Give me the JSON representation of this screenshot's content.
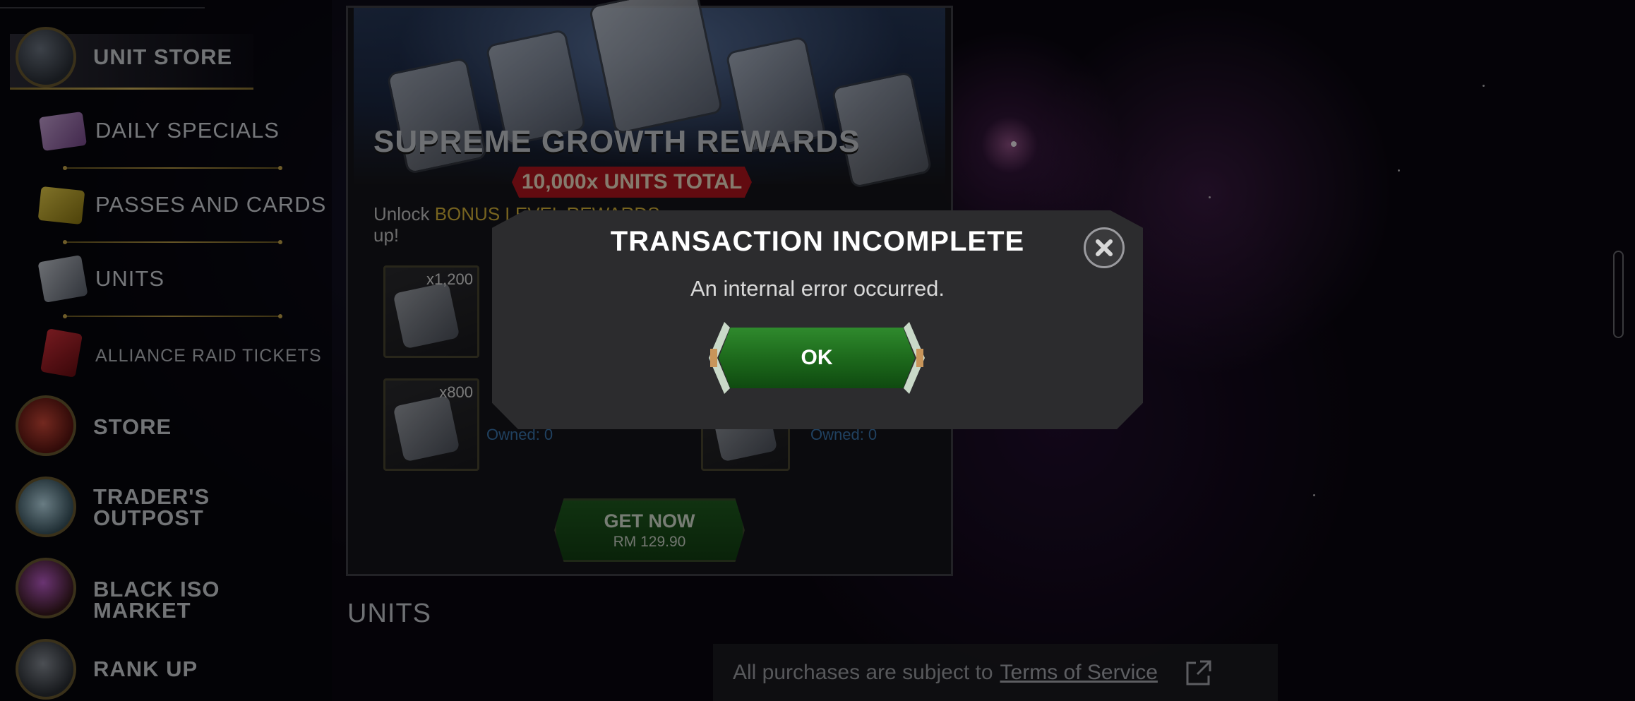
{
  "sidebar": {
    "items": [
      {
        "label": "UNIT STORE",
        "icon": "unit-store-icon"
      },
      {
        "label": "DAILY SPECIALS",
        "icon": "daily-specials-icon"
      },
      {
        "label": "PASSES AND CARDS",
        "icon": "passes-cards-icon"
      },
      {
        "label": "UNITS",
        "icon": "units-icon"
      },
      {
        "label": "ALLIANCE RAID TICKETS",
        "icon": "raid-ticket-icon"
      },
      {
        "label": "STORE",
        "icon": "store-icon"
      },
      {
        "label": "TRADER'S OUTPOST",
        "icon": "crystal-icon"
      },
      {
        "label": "BLACK ISO MARKET",
        "icon": "black-iso-icon"
      },
      {
        "label": "RANK UP",
        "icon": "rank-up-icon"
      }
    ]
  },
  "offer": {
    "title": "SUPREME GROWTH REWARDS",
    "units_total": "10,000x UNITS TOTAL",
    "unlock_prefix": "Unlock",
    "unlock_highlight": "BONUS LEVEL REWARDS",
    "unlock_suffix": "up!",
    "rewards": [
      {
        "qty": "x1,200"
      },
      {
        "qty": "x800",
        "owned": "Owned: 0"
      },
      {
        "owned": "Owned: 0"
      }
    ],
    "get_now_label": "GET NOW",
    "get_now_price": "RM 129.90"
  },
  "section_heading": "UNITS",
  "footer": {
    "text": "All purchases are subject to",
    "link": "Terms of Service",
    "icon": "external-link-icon"
  },
  "dialog": {
    "title": "TRANSACTION INCOMPLETE",
    "message": "An internal error occurred.",
    "ok_label": "OK",
    "close_icon": "close-icon"
  },
  "colors": {
    "ok_green": "#1d6a1c",
    "highlight_gold": "#d8b53a",
    "badge_red": "#b3141e",
    "owned_blue": "#3b77b0"
  }
}
